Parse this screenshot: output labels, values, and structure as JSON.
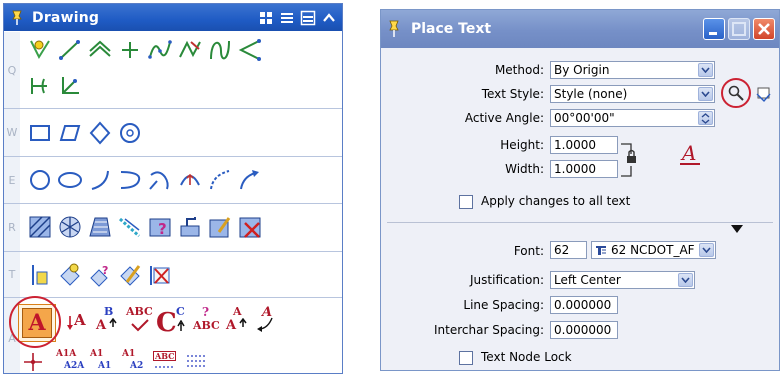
{
  "drawing_toolbox": {
    "title": "Drawing",
    "row_labels": [
      "Q",
      "W",
      "E",
      "R",
      "T",
      "A"
    ],
    "text_icons": {
      "place_text": "A",
      "edit_text_b": "B",
      "edit_text_b_a": "A",
      "abc": "ABC",
      "c_label": "C",
      "c_sup": "C",
      "abc_q": "?",
      "abc_q_base": "ABC",
      "a_up_top": "A",
      "a_up_bottom": "A",
      "a_down": "A",
      "a1a": "A1A",
      "a2a": "A2A",
      "a1_top": "A1",
      "a1_bottom": "A1",
      "a1_2_top": "A1",
      "a1_2_bottom": "A2",
      "abc_box": "ABC"
    }
  },
  "place_text": {
    "title": "Place Text",
    "method": {
      "label": "Method:",
      "accel": "M",
      "value": "By Origin"
    },
    "text_style": {
      "label": "Text Style:",
      "accel": "T",
      "value": "Style (none)"
    },
    "active_angle": {
      "label": "Active Angle:",
      "value": "00°00'00\""
    },
    "height": {
      "label": "Height:",
      "accel": "H",
      "value": "1.0000"
    },
    "width": {
      "label": "Width:",
      "accel": "W",
      "value": "1.0000"
    },
    "apply_changes": {
      "label": "Apply changes to all text",
      "accel": "c",
      "checked": false
    },
    "font": {
      "label": "Font:",
      "accel": "F",
      "number": "62",
      "value": "62   NCDOT_AF"
    },
    "justification": {
      "label": "Justification:",
      "accel": "J",
      "value": "Left Center"
    },
    "line_spacing": {
      "label": "Line Spacing:",
      "accel": "L",
      "value": "0.000000"
    },
    "interchar_spacing": {
      "label": "Interchar Spacing:",
      "accel": "I",
      "value": "0.000000"
    },
    "text_node_lock": {
      "label": "Text Node Lock",
      "accel": "T",
      "checked": false
    }
  },
  "colors": {
    "title_blue": "#1f5bc4",
    "dialog_title": "#7690c8",
    "highlight_red": "#cc2233",
    "tool_orange": "#f4a64a"
  }
}
